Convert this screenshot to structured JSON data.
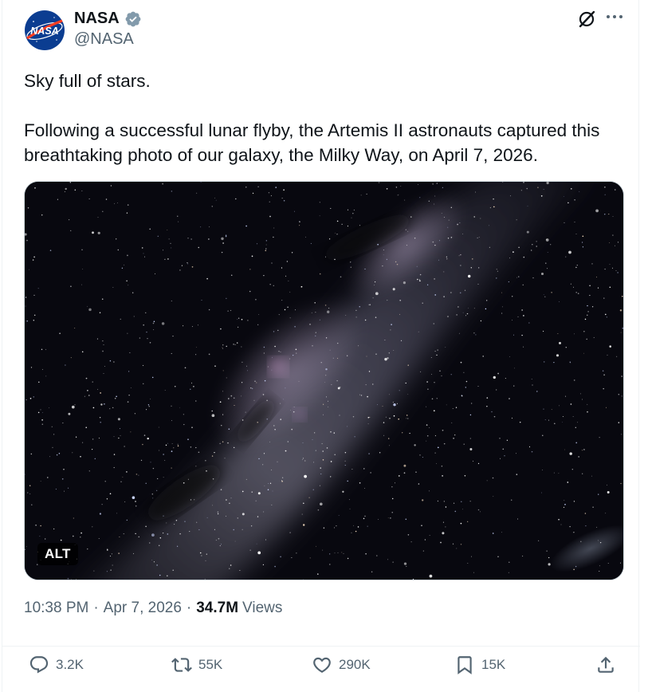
{
  "author": {
    "display_name": "NASA",
    "handle": "@NASA",
    "avatar_text": "NASA",
    "verified": true
  },
  "tweet": {
    "paragraphs": [
      "Sky full of stars.",
      "Following a successful lunar flyby, the Artemis II astronauts captured this breathtaking photo of our galaxy, the Milky Way, on April 7, 2026."
    ]
  },
  "media": {
    "alt_label": "ALT"
  },
  "meta": {
    "time": "10:38 PM",
    "separator": "·",
    "date": "Apr 7, 2026",
    "views_count": "34.7M",
    "views_label": "Views"
  },
  "actions": {
    "replies": "3.2K",
    "reposts": "55K",
    "likes": "290K",
    "bookmarks": "15K"
  },
  "icons": {
    "verified": "verified-badge-icon",
    "grok": "grok-icon",
    "more": "more-icon",
    "reply": "reply-icon",
    "repost": "repost-icon",
    "like": "heart-icon",
    "bookmark": "bookmark-icon",
    "share": "share-icon"
  },
  "colors": {
    "verified_blue": "#1d9bf0",
    "secondary_text": "#536471",
    "primary_text": "#0f1419"
  }
}
